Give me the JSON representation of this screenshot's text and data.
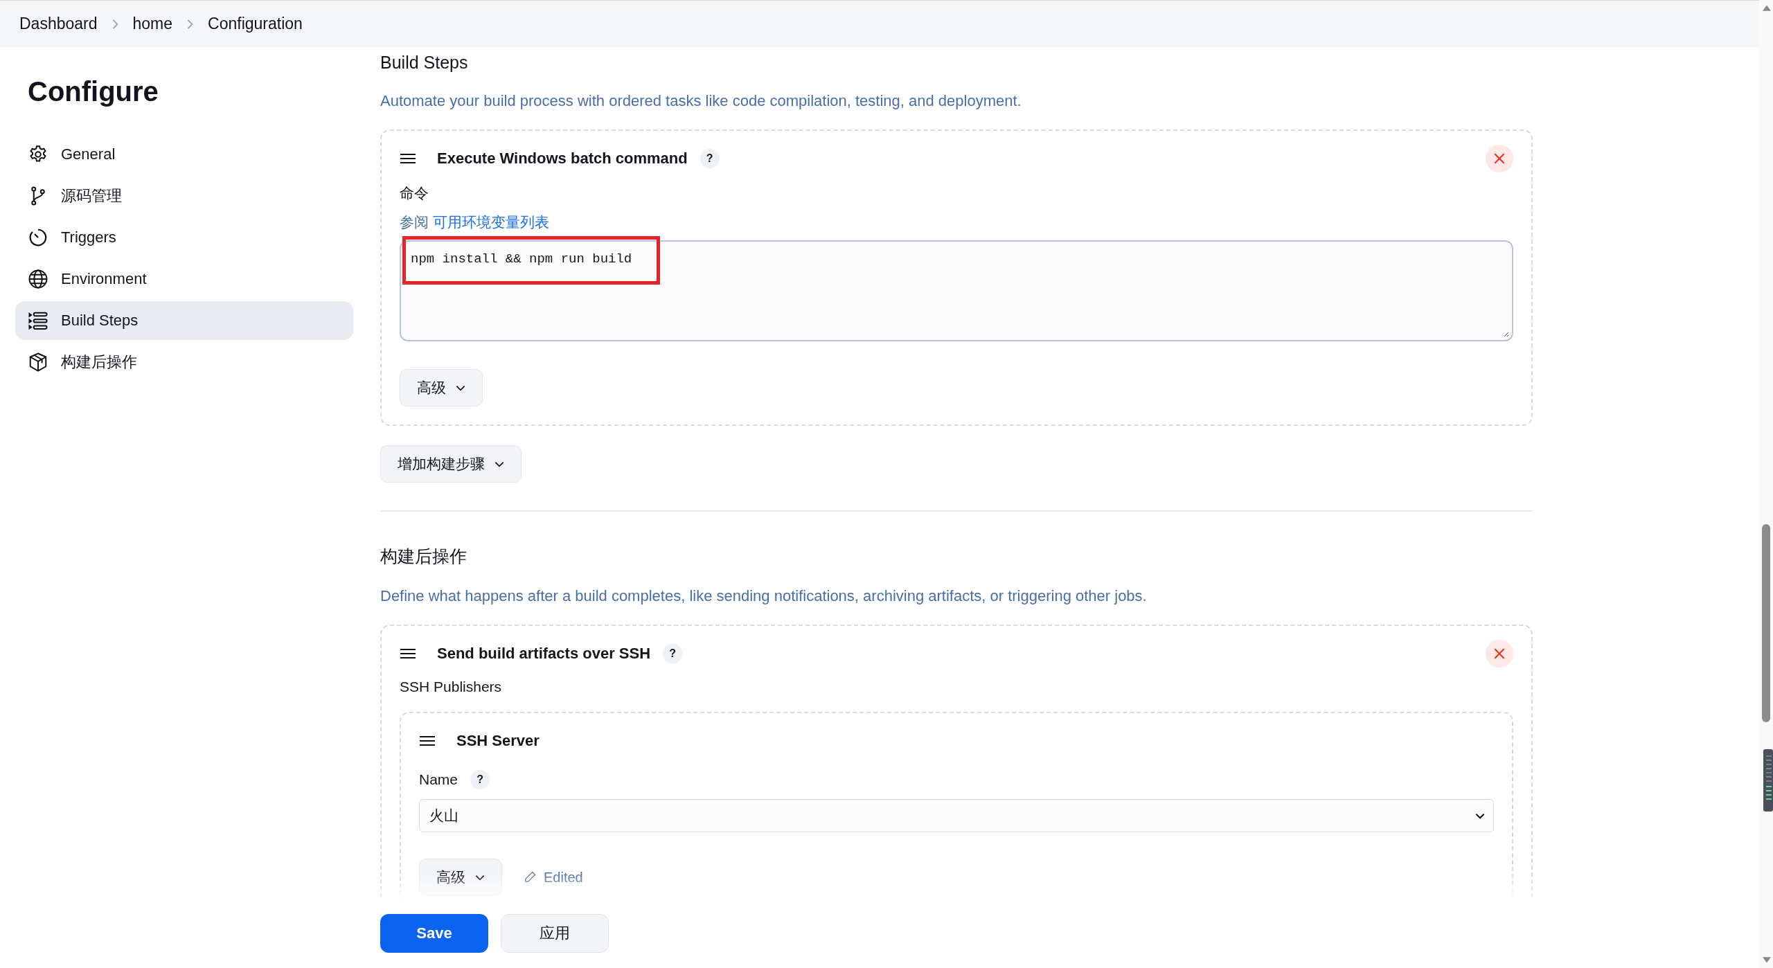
{
  "breadcrumb": [
    "Dashboard",
    "home",
    "Configuration"
  ],
  "sidebar": {
    "title": "Configure",
    "items": [
      {
        "label": "General",
        "selected": false
      },
      {
        "label": "源码管理",
        "selected": false
      },
      {
        "label": "Triggers",
        "selected": false
      },
      {
        "label": "Environment",
        "selected": false
      },
      {
        "label": "Build Steps",
        "selected": true
      },
      {
        "label": "构建后操作",
        "selected": false
      }
    ]
  },
  "build_steps": {
    "heading": "Build Steps",
    "description": "Automate your build process with ordered tasks like code compilation, testing, and deployment.",
    "step": {
      "title": "Execute Windows batch command",
      "help": "?",
      "field_label": "命令",
      "hint_prefix": "参阅",
      "hint_link": "可用环境变量列表",
      "command": "npm install && npm run build",
      "advanced_button": "高级"
    },
    "add_button": "增加构建步骤"
  },
  "post_build": {
    "heading": "构建后操作",
    "description": "Define what happens after a build completes, like sending notifications, archiving artifacts, or triggering other jobs.",
    "step": {
      "title": "Send build artifacts over SSH",
      "help": "?",
      "publishers_label": "SSH Publishers",
      "server": {
        "title": "SSH Server",
        "name_label": "Name",
        "help": "?",
        "name_value": "火山",
        "advanced_button": "高级",
        "edited": "Edited"
      }
    }
  },
  "footer": {
    "save": "Save",
    "apply": "应用"
  }
}
